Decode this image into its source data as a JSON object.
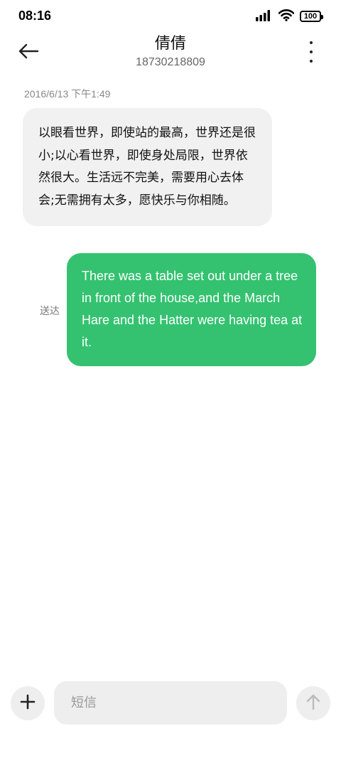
{
  "status_bar": {
    "time": "08:16",
    "battery": "100",
    "icons": [
      "signal-icon",
      "wifi-icon",
      "battery-icon"
    ]
  },
  "header": {
    "back_icon": "back-arrow-icon",
    "contact_name": "倩倩",
    "contact_number": "18730218809",
    "more_icon": "more-vertical-icon"
  },
  "conversation": {
    "timestamp": "2016/6/13 下午1:49",
    "incoming_message": "以眼看世界，即使站的最高，世界还是很小;以心看世界，即使身处局限，世界依然很大。生活远不完美，需要用心去体会;无需拥有太多，愿快乐与你相随。",
    "outgoing_message": "There was a table set out under a tree in front of the house,and the March Hare and the Hatter were having tea at it.",
    "delivery_status": "送达"
  },
  "composer": {
    "add_icon": "plus-icon",
    "placeholder": "短信",
    "send_icon": "send-arrow-icon"
  },
  "colors": {
    "incoming_bubble": "#f1f1f1",
    "outgoing_bubble": "#34c270",
    "background": "#ffffff"
  }
}
